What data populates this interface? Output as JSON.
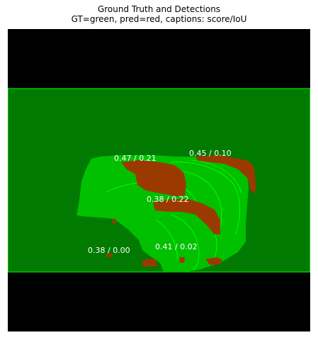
{
  "header": {
    "title": "Ground Truth and Detections",
    "subtitle": "GT=green, pred=red, captions: score/IoU"
  },
  "colors": {
    "background": "#000000",
    "gt_box": "#007a00",
    "gt_mask": "#00c000",
    "gt_outline": "#00ff00",
    "pred": "#9b3a00"
  },
  "detections": [
    {
      "caption": "0.47 / 0.21",
      "score": 0.47,
      "iou": 0.21
    },
    {
      "caption": "0.45 / 0.10",
      "score": 0.45,
      "iou": 0.1
    },
    {
      "caption": "0.38 / 0.22",
      "score": 0.38,
      "iou": 0.22
    },
    {
      "caption": "0.38 / 0.00",
      "score": 0.38,
      "iou": 0.0
    },
    {
      "caption": "0.41 / 0.02",
      "score": 0.41,
      "iou": 0.02
    }
  ]
}
